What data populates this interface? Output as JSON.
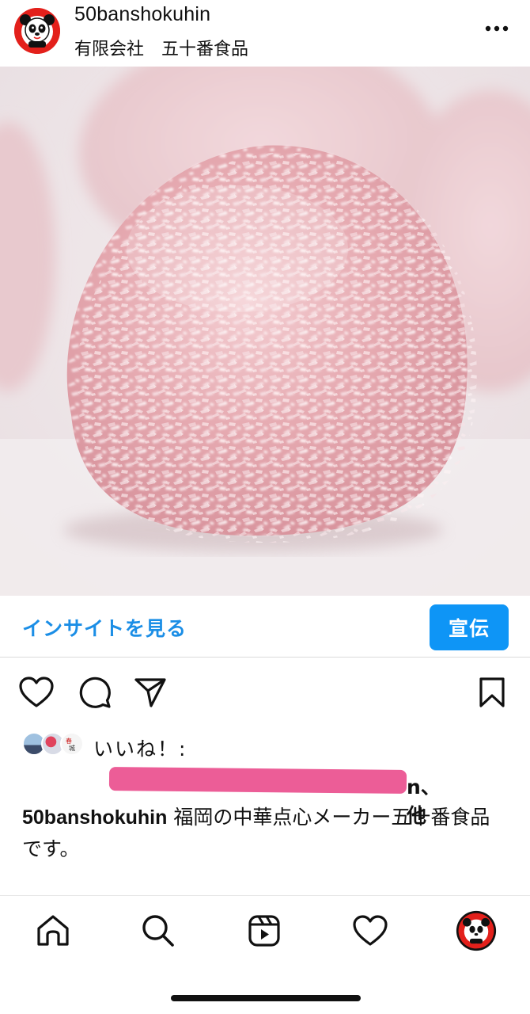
{
  "header": {
    "username": "50banshokuhin",
    "subtitle": "有限会社　五十番食品",
    "avatar_icon": "panda-logo-icon",
    "more_icon": "more-horizontal-icon"
  },
  "post": {
    "image_alt_subject": "pink coconut-coated mochi ball"
  },
  "insights": {
    "link_label": "インサイトを見る",
    "promote_label": "宣伝",
    "link_color": "#1b8ee6",
    "button_color": "#0e95f6"
  },
  "actions": {
    "like_icon": "heart-outline-icon",
    "comment_icon": "comment-bubble-icon",
    "share_icon": "paper-plane-icon",
    "save_icon": "bookmark-icon"
  },
  "likes": {
    "label": "いいね！:",
    "others_suffix": "n、他",
    "redaction_color": "#ec5d97"
  },
  "caption": {
    "author": "50banshokuhin",
    "text": " 福岡の中華点心メーカー五十番食品です。"
  },
  "tabbar": {
    "items": [
      "home-icon",
      "search-icon",
      "reels-icon",
      "activity-heart-icon",
      "profile-avatar-icon"
    ]
  }
}
